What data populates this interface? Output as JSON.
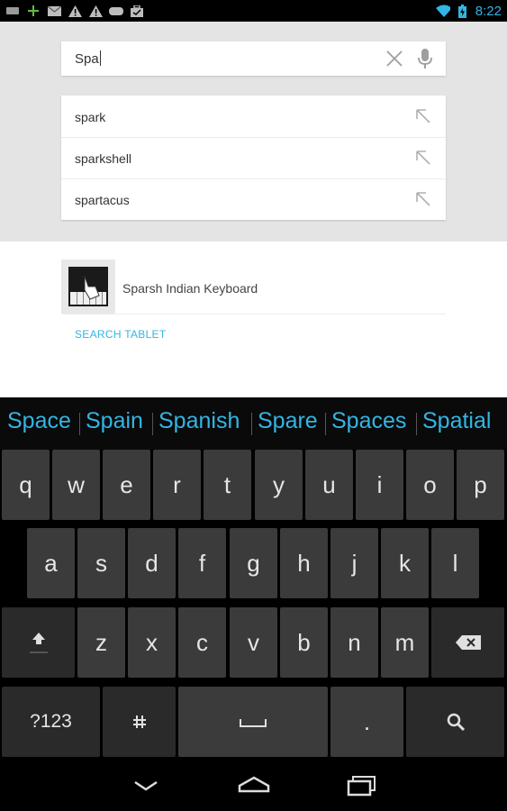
{
  "status_bar": {
    "time": "8:22",
    "left_icons": [
      "keyboard-icon",
      "plus-icon",
      "mail-icon",
      "warning-icon",
      "warning-icon",
      "gamepad-icon",
      "briefcase-icon"
    ],
    "right_icons": [
      "wifi-icon",
      "battery-icon"
    ],
    "accent_color": "#33b5e5"
  },
  "search": {
    "query": "Spa",
    "clear_icon": "clear-icon",
    "mic_icon": "mic-icon"
  },
  "suggestions": [
    {
      "prefix": "spa",
      "rest": "rk"
    },
    {
      "prefix": "spa",
      "rest": "rkshell"
    },
    {
      "prefix": "spa",
      "rest": "rtacus"
    }
  ],
  "results": {
    "app_name": "Sparsh Indian Keyboard",
    "search_tablet_label": "SEARCH TABLET"
  },
  "keyboard": {
    "candidates": [
      "Space",
      "Spain",
      "Spanish",
      "Spare",
      "Spaces",
      "Spatial"
    ],
    "row1": [
      "q",
      "w",
      "e",
      "r",
      "t",
      "y",
      "u",
      "i",
      "o",
      "p"
    ],
    "row2": [
      "a",
      "s",
      "d",
      "f",
      "g",
      "h",
      "j",
      "k",
      "l"
    ],
    "row3": [
      "z",
      "x",
      "c",
      "v",
      "b",
      "n",
      "m"
    ],
    "symbols_label": "?123",
    "period_label": "."
  },
  "navbar": {
    "buttons": [
      "back-icon",
      "home-icon",
      "recents-icon"
    ]
  }
}
